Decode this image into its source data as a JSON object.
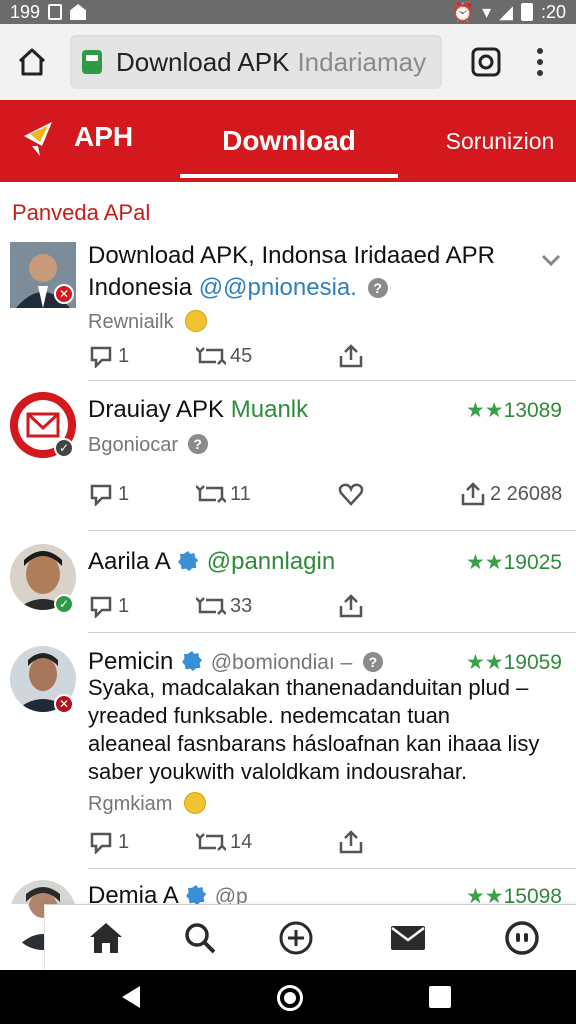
{
  "status_bar": {
    "left_text": "199",
    "right_text": ":20"
  },
  "browser": {
    "url_title": "Download APK",
    "url_sub": "Indariamay"
  },
  "app_header": {
    "logo_text": "APH",
    "active_tab": "Download",
    "other_tab": "Sorunizion"
  },
  "section_title": "Panveda APal",
  "posts": [
    {
      "name": "Download APK, Indonsa Iridaaed APR",
      "name_line2": "Indonesia",
      "handle": "@@pnionesia.",
      "subtext": "Rewniailk",
      "reply": "1",
      "retweet": "45",
      "extra": ""
    },
    {
      "name": "Drauiay APK",
      "handle": "Muanlk",
      "stars": "13089",
      "subtext": "Bgoniocar",
      "reply": "1",
      "retweet": "11",
      "share_count": "2 26088"
    },
    {
      "name": "Aarila A",
      "handle": "@pannlagin",
      "stars": "19025",
      "reply": "1",
      "retweet": "33"
    },
    {
      "name": "Pemicin",
      "handle": "@bomiondiaı –",
      "stars": "19059",
      "body_lines": [
        "Syaka, madcalakan thanenadanduitan plud –",
        "yreaded funksable. nedemcatan tuan",
        "aleaneal fasnbarans hásloafnan kan ihaaa lisy",
        "saber youkwith valoldkam indousrahar."
      ],
      "subtext": "Rgmkiam",
      "reply": "1",
      "retweet": "14"
    },
    {
      "name": "Demia A",
      "handle": "@p",
      "stars": "15098"
    }
  ],
  "colors": {
    "brand_red": "#d3191d",
    "link_blue": "#2f7fc1",
    "star_green": "#3aa04a"
  },
  "icons": {
    "nav": [
      "home-icon",
      "search-icon",
      "add-circle-icon",
      "mail-icon",
      "profile-icon"
    ]
  }
}
